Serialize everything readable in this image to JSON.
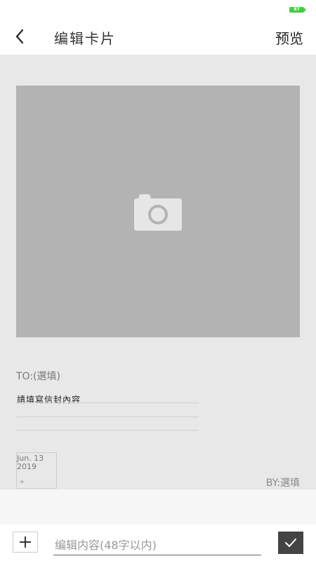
{
  "status_bar": {
    "battery_level": "87",
    "battery_color": "#3fcf3f"
  },
  "header": {
    "back_icon": "chevron-left-icon",
    "title": "编辑卡片",
    "preview_label": "预览"
  },
  "card": {
    "photo_icon": "camera-icon",
    "to_label": "TO:(選填)",
    "content_placeholder": "請填寫信封內容",
    "date_line1": "Jun. 13",
    "date_line2": "2019",
    "date_add": "+",
    "by_label": "BY:選填"
  },
  "bottom_bar": {
    "add_icon": "plus-icon",
    "input_placeholder": "编辑内容(48字以内)",
    "input_value": "",
    "confirm_icon": "check-icon"
  },
  "colors": {
    "card_background": "#e8e8e8",
    "photo_placeholder": "#b3b3b3",
    "confirm_button": "#444444"
  }
}
